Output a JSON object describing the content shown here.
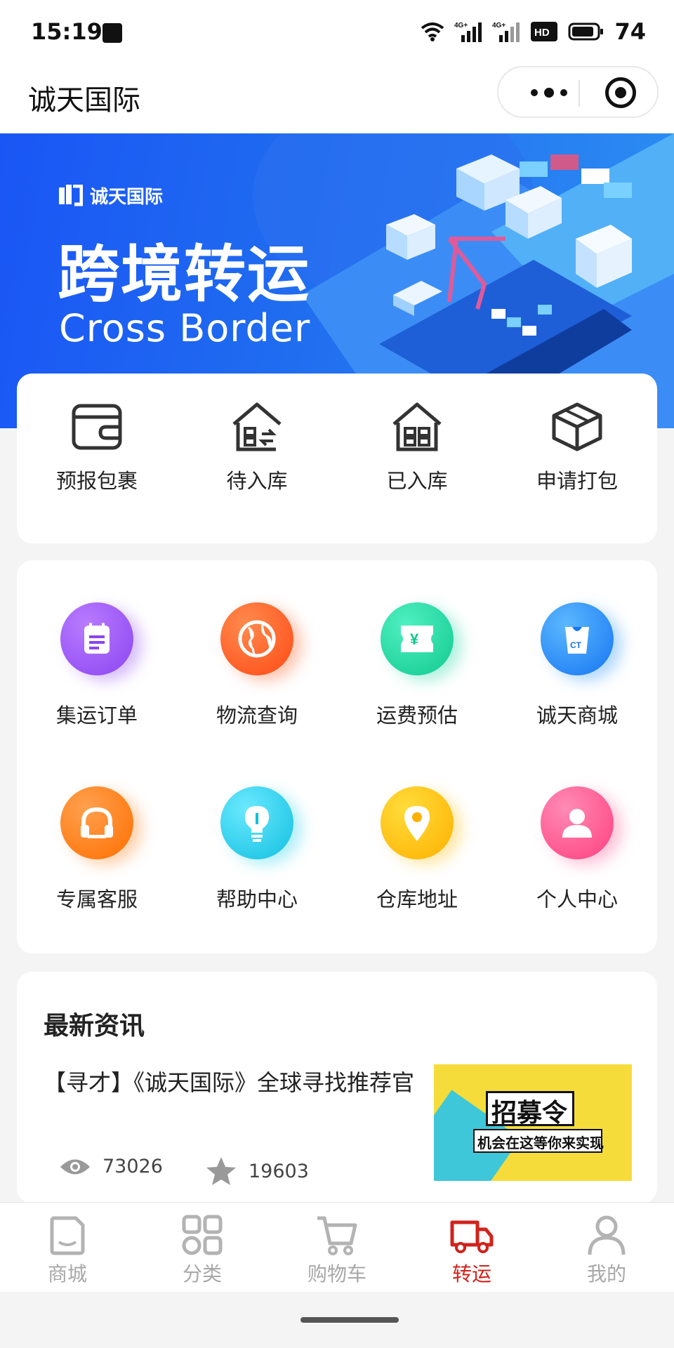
{
  "status_bar": {
    "time": "15:19",
    "network_1": "4G+",
    "network_2": "4G+",
    "hd": "HD",
    "battery": "74"
  },
  "nav": {
    "title": "诚天国际",
    "more_icon": "more-dots-icon",
    "close_icon": "target-icon"
  },
  "banner": {
    "logo_text": "诚天国际",
    "headline": "跨境转运",
    "subheadline": "Cross Border"
  },
  "quick_actions": [
    {
      "label": "预报包裹",
      "icon": "wallet-icon"
    },
    {
      "label": "待入库",
      "icon": "pending-warehouse-icon"
    },
    {
      "label": "已入库",
      "icon": "warehouse-icon"
    },
    {
      "label": "申请打包",
      "icon": "package-box-icon"
    }
  ],
  "features": [
    {
      "label": "集运订单",
      "icon": "order-list-icon",
      "color": "#8b45f0"
    },
    {
      "label": "物流查询",
      "icon": "globe-icon",
      "color": "#ff5a1e"
    },
    {
      "label": "运费预估",
      "icon": "ticket-yen-icon",
      "color": "#19d6a0"
    },
    {
      "label": "诚天商城",
      "icon": "shopping-bag-icon",
      "color": "#1c8ef5"
    },
    {
      "label": "专属客服",
      "icon": "headset-icon",
      "color": "#ff7a10"
    },
    {
      "label": "帮助中心",
      "icon": "lightbulb-icon",
      "color": "#1ed0ec"
    },
    {
      "label": "仓库地址",
      "icon": "location-pin-icon",
      "color": "#ffbd00"
    },
    {
      "label": "个人中心",
      "icon": "user-icon",
      "color": "#ff4f8e"
    }
  ],
  "news": {
    "section_title": "最新资讯",
    "item_title": "【寻才】《诚天国际》全球寻找推荐官",
    "views": "73026",
    "stars": "19603",
    "thumb_title": "招募令",
    "thumb_sub": "机会在这等你来实现"
  },
  "tabbar": [
    {
      "label": "商城",
      "icon": "shop-bag-icon",
      "active": false
    },
    {
      "label": "分类",
      "icon": "category-grid-icon",
      "active": false
    },
    {
      "label": "购物车",
      "icon": "cart-icon",
      "active": false
    },
    {
      "label": "转运",
      "icon": "truck-icon",
      "active": true
    },
    {
      "label": "我的",
      "icon": "profile-icon",
      "active": false
    }
  ],
  "colors": {
    "accent": "#d0231c",
    "banner": "#1a56f5"
  }
}
